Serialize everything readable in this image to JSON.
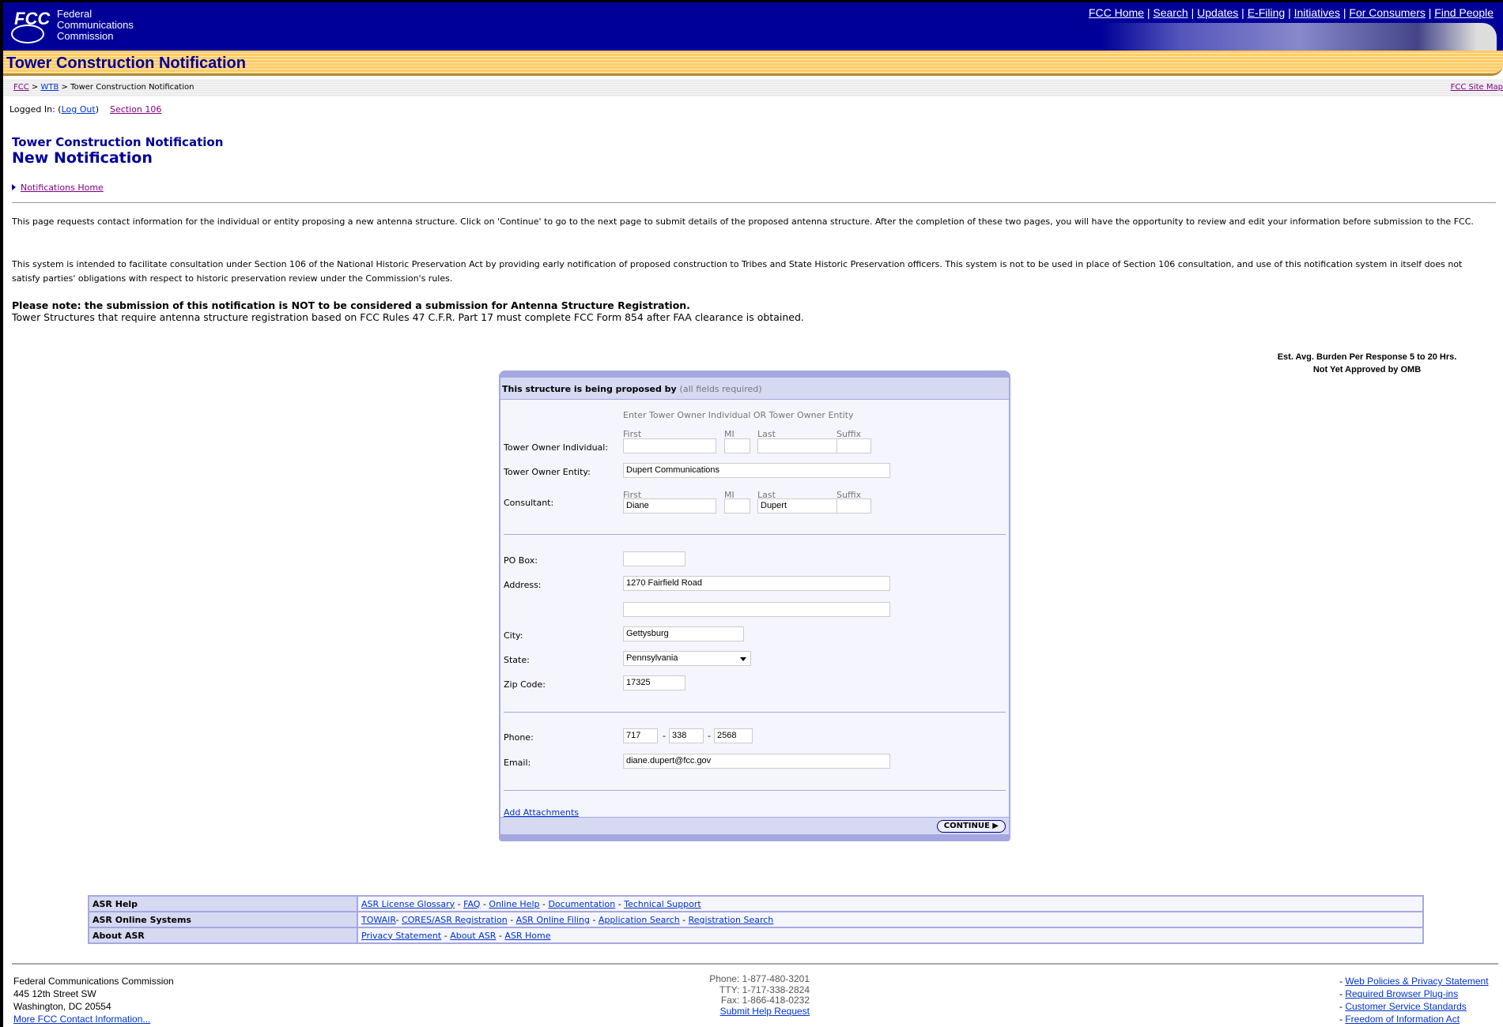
{
  "header": {
    "logo_abbr": "FCC",
    "logo_name": [
      "Federal",
      "Communications",
      "Commission"
    ],
    "top_links": [
      "FCC Home",
      "Search",
      "Updates",
      "E-Filing",
      "Initiatives",
      "For Consumers",
      "Find People"
    ],
    "page_banner": "Tower Construction Notification"
  },
  "breadcrumb": {
    "items": [
      "FCC",
      "WTB"
    ],
    "current": "Tower Construction Notification",
    "site_map": "FCC Site Map"
  },
  "login": {
    "label": "Logged In: (",
    "logout": "Log Out",
    "close": ")",
    "section": "Section 106"
  },
  "titles": {
    "app": "Tower Construction Notification",
    "page": "New Notification"
  },
  "notifications_home": "Notifications Home",
  "paragraphs": [
    "This page requests contact information for the individual or entity proposing a new antenna structure. Click on 'Continue' to go to the next page to submit details of the proposed antenna structure. After the completion of these two pages, you will have the opportunity to review and edit your information before submission to the FCC.",
    "This system is intended to facilitate consultation under Section 106 of the National Historic Preservation Act by providing early notification of proposed construction to Tribes and State Historic Preservation officers. This system is not to be used in place of Section 106 consultation, and use of this notification system in itself does not satisfy parties' obligations with respect to historic preservation review under the Commission's rules."
  ],
  "note": {
    "bold": "Please note: the submission of this notification is NOT to be considered a submission for Antenna Structure Registration.",
    "text": "Tower Structures that require antenna structure registration based on FCC Rules 47 C.F.R. Part 17 must complete FCC Form 854 after FAA clearance is obtained."
  },
  "burden": [
    "Est. Avg. Burden Per Response 5 to 20 Hrs.",
    "Not Yet Approved by OMB"
  ],
  "form": {
    "heading": "This structure is being proposed by",
    "heading_note": "(all fields required)",
    "hint": "Enter Tower Owner Individual OR Tower Owner Entity",
    "sub_labels": {
      "first": "First",
      "mi": "MI",
      "last": "Last",
      "suffix": "Suffix"
    },
    "labels": {
      "individual": "Tower Owner Individual:",
      "entity": "Tower Owner Entity:",
      "consultant": "Consultant:",
      "po_box": "PO Box:",
      "address": "Address:",
      "city": "City:",
      "state": "State:",
      "zip": "Zip Code:",
      "phone": "Phone:",
      "email": "Email:"
    },
    "values": {
      "ind_first": "",
      "ind_mi": "",
      "ind_last": "",
      "ind_suffix": "",
      "entity": "Dupert Communications",
      "con_first": "Diane",
      "con_mi": "",
      "con_last": "Dupert",
      "con_suffix": "",
      "po_box": "",
      "address1": "1270 Fairfield Road",
      "address2": "",
      "city": "Gettysburg",
      "state": "Pennsylvania",
      "zip": "17325",
      "phone1": "717",
      "phone2": "338",
      "phone3": "2568",
      "email": "diane.dupert@fcc.gov"
    },
    "phone_sep": "-",
    "add_attachments": "Add Attachments",
    "continue": "CONTINUE"
  },
  "footer_table": [
    {
      "label": "ASR Help",
      "links": [
        "ASR License Glossary",
        "FAQ",
        "Online Help",
        "Documentation",
        "Technical Support"
      ]
    },
    {
      "label": "ASR Online Systems",
      "links": [
        "TOWAIR",
        "CORES/ASR Registration",
        "ASR Online Filing",
        "Application Search",
        "Registration Search"
      ]
    },
    {
      "label": "About ASR",
      "links": [
        "Privacy Statement",
        "About ASR",
        "ASR Home"
      ]
    }
  ],
  "footer": {
    "address": [
      "Federal Communications Commission",
      "445 12th Street SW",
      "Washington, DC 20554"
    ],
    "more_contact": "More FCC Contact Information...",
    "contact": [
      "Phone: 1-877-480-3201",
      "TTY: 1-717-338-2824",
      "Fax: 1-866-418-0232"
    ],
    "help": "Submit Help Request",
    "links": [
      "Web Policies & Privacy Statement",
      "Required Browser Plug-ins",
      "Customer Service Standards",
      "Freedom of Information Act"
    ]
  }
}
